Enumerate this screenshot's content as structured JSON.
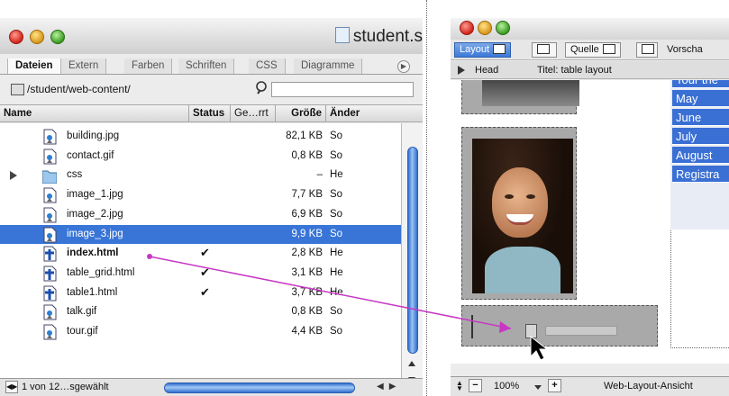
{
  "left_window": {
    "title": "student.s",
    "tabs": [
      "Dateien",
      "Extern",
      "Farben",
      "Schriften",
      "CSS",
      "Diagramme"
    ],
    "path": "/student/web-content/",
    "search_placeholder": "",
    "columns": [
      "Name",
      "Status",
      "Ge…rrt",
      "Größe",
      "Änder"
    ],
    "files": [
      {
        "name": "building.jpg",
        "type": "image",
        "status": "",
        "size": "82,1 KB",
        "changed": "So",
        "bold": false,
        "selected": false
      },
      {
        "name": "contact.gif",
        "type": "image",
        "status": "",
        "size": "0,8 KB",
        "changed": "So",
        "bold": false,
        "selected": false
      },
      {
        "name": "css",
        "type": "folder",
        "status": "",
        "size": "–",
        "changed": "He",
        "bold": false,
        "selected": false
      },
      {
        "name": "image_1.jpg",
        "type": "image",
        "status": "",
        "size": "7,7 KB",
        "changed": "So",
        "bold": false,
        "selected": false
      },
      {
        "name": "image_2.jpg",
        "type": "image",
        "status": "",
        "size": "6,9 KB",
        "changed": "So",
        "bold": false,
        "selected": false
      },
      {
        "name": "image_3.jpg",
        "type": "image",
        "status": "",
        "size": "9,9 KB",
        "changed": "So",
        "bold": false,
        "selected": true
      },
      {
        "name": "index.html",
        "type": "html",
        "status": "✔",
        "size": "2,8 KB",
        "changed": "He",
        "bold": true,
        "selected": false
      },
      {
        "name": "table_grid.html",
        "type": "html",
        "status": "✔",
        "size": "3,1 KB",
        "changed": "He",
        "bold": false,
        "selected": false
      },
      {
        "name": "table1.html",
        "type": "html",
        "status": "✔",
        "size": "3,7 KB",
        "changed": "He",
        "bold": false,
        "selected": false
      },
      {
        "name": "talk.gif",
        "type": "image",
        "status": "",
        "size": "0,8 KB",
        "changed": "So",
        "bold": false,
        "selected": false
      },
      {
        "name": "tour.gif",
        "type": "image",
        "status": "",
        "size": "4,4 KB",
        "changed": "So",
        "bold": false,
        "selected": false
      }
    ],
    "status_text": "1 von 12…sgewählt"
  },
  "right_window": {
    "toolbar": {
      "layout_label": "Layout",
      "source_label": "Quelle",
      "preview_label": "Vorscha"
    },
    "head_label": "Head",
    "title_label": "Titel: table layout",
    "nav_items": [
      "Tour the",
      "May",
      "June",
      "July",
      "August",
      "Registra"
    ],
    "zoom": "100%",
    "view_label": "Web-Layout-Ansicht"
  },
  "colors": {
    "selection": "#3875d7",
    "nav_blue": "#3a6fd4",
    "drag_arrow": "#c837c4"
  }
}
